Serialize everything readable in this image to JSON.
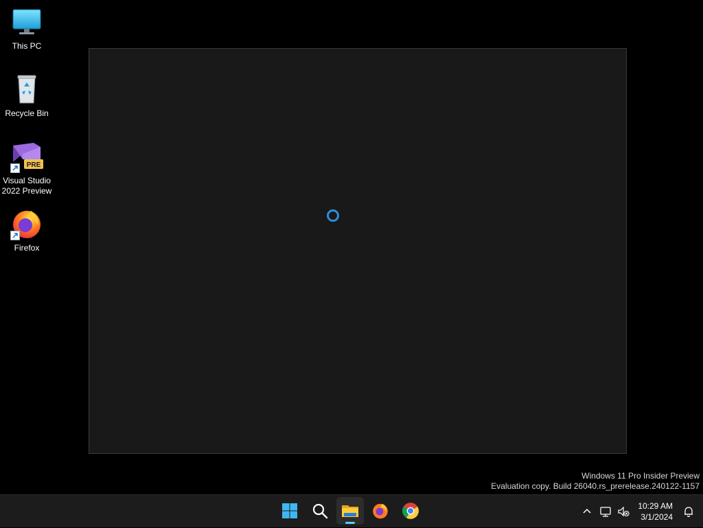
{
  "desktop": {
    "icons": [
      {
        "label": "This PC",
        "icon": "monitor-icon"
      },
      {
        "label": "Recycle Bin",
        "icon": "recycle-bin-icon"
      },
      {
        "label": "Visual Studio\n2022 Preview",
        "icon": "visual-studio-preview-icon",
        "badge": "PRE"
      },
      {
        "label": "Firefox",
        "icon": "firefox-icon"
      }
    ]
  },
  "window": {
    "state": "loading",
    "spinner_color": "#2b8fe0"
  },
  "watermark": {
    "line1": "Windows 11 Pro Insider Preview",
    "line2": "Evaluation copy. Build 26040.rs_prerelease.240122-1157"
  },
  "taskbar": {
    "pinned": [
      {
        "name": "start",
        "icon": "windows-start-icon"
      },
      {
        "name": "search",
        "icon": "search-icon"
      },
      {
        "name": "file-explorer",
        "icon": "folder-icon",
        "active": true
      },
      {
        "name": "firefox",
        "icon": "firefox-icon"
      },
      {
        "name": "chrome",
        "icon": "chrome-icon"
      }
    ],
    "tray": {
      "time": "10:29 AM",
      "date": "3/1/2024",
      "icons": [
        "chevron-up-icon",
        "network-icon",
        "volume-muted-icon",
        "notification-bell-icon"
      ]
    },
    "accent": "#60cdff"
  }
}
